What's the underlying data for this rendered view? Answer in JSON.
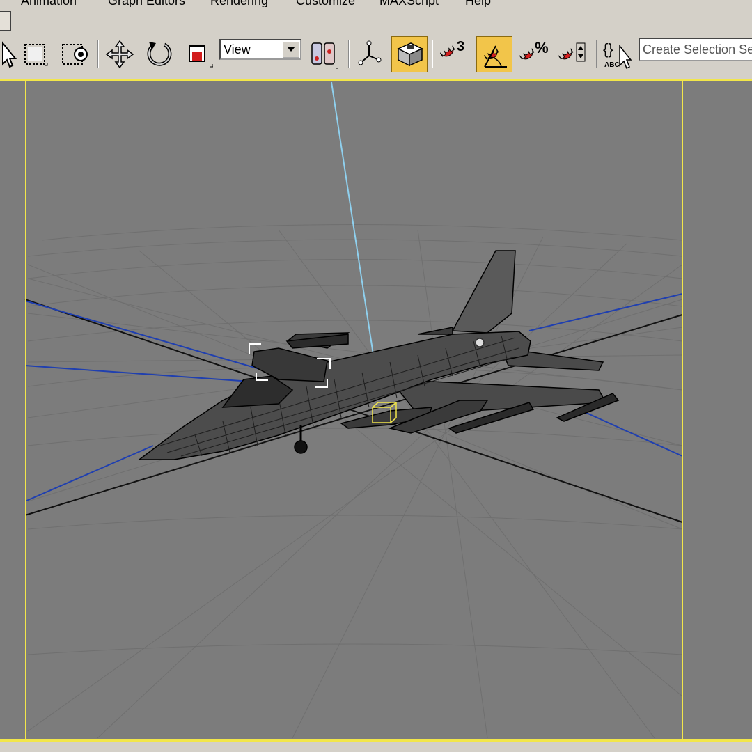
{
  "menu": {
    "items": [
      "Animation",
      "Graph Editors",
      "Rendering",
      "Customize",
      "MAXScript",
      "Help"
    ]
  },
  "toolbar": {
    "view_dropdown_value": "View",
    "angle_snap_superscript": "3",
    "named_selection_placeholder": "Create Selection Set",
    "edit_named_selection_label": "ABC"
  },
  "colors": {
    "ui_gray": "#d4d0c8",
    "viewport_bg": "#7c7c7c",
    "active_viewport_border": "#f2e64a",
    "active_button": "#f2c54a",
    "grid_line": "#6f6f6f",
    "axis_blue": "#1f3fb0",
    "light_beam": "#8fd0ee"
  },
  "icons": [
    "select-icon",
    "rect-region-icon",
    "window-crossing-icon",
    "move-icon",
    "rotate-icon",
    "scale-icon",
    "mirror-icon",
    "pivot-icon",
    "keyboard-shortcut-override-icon",
    "snap-3d-icon",
    "angle-snap-icon",
    "percent-snap-icon",
    "spinner-snap-icon",
    "edit-named-selection-icon"
  ]
}
